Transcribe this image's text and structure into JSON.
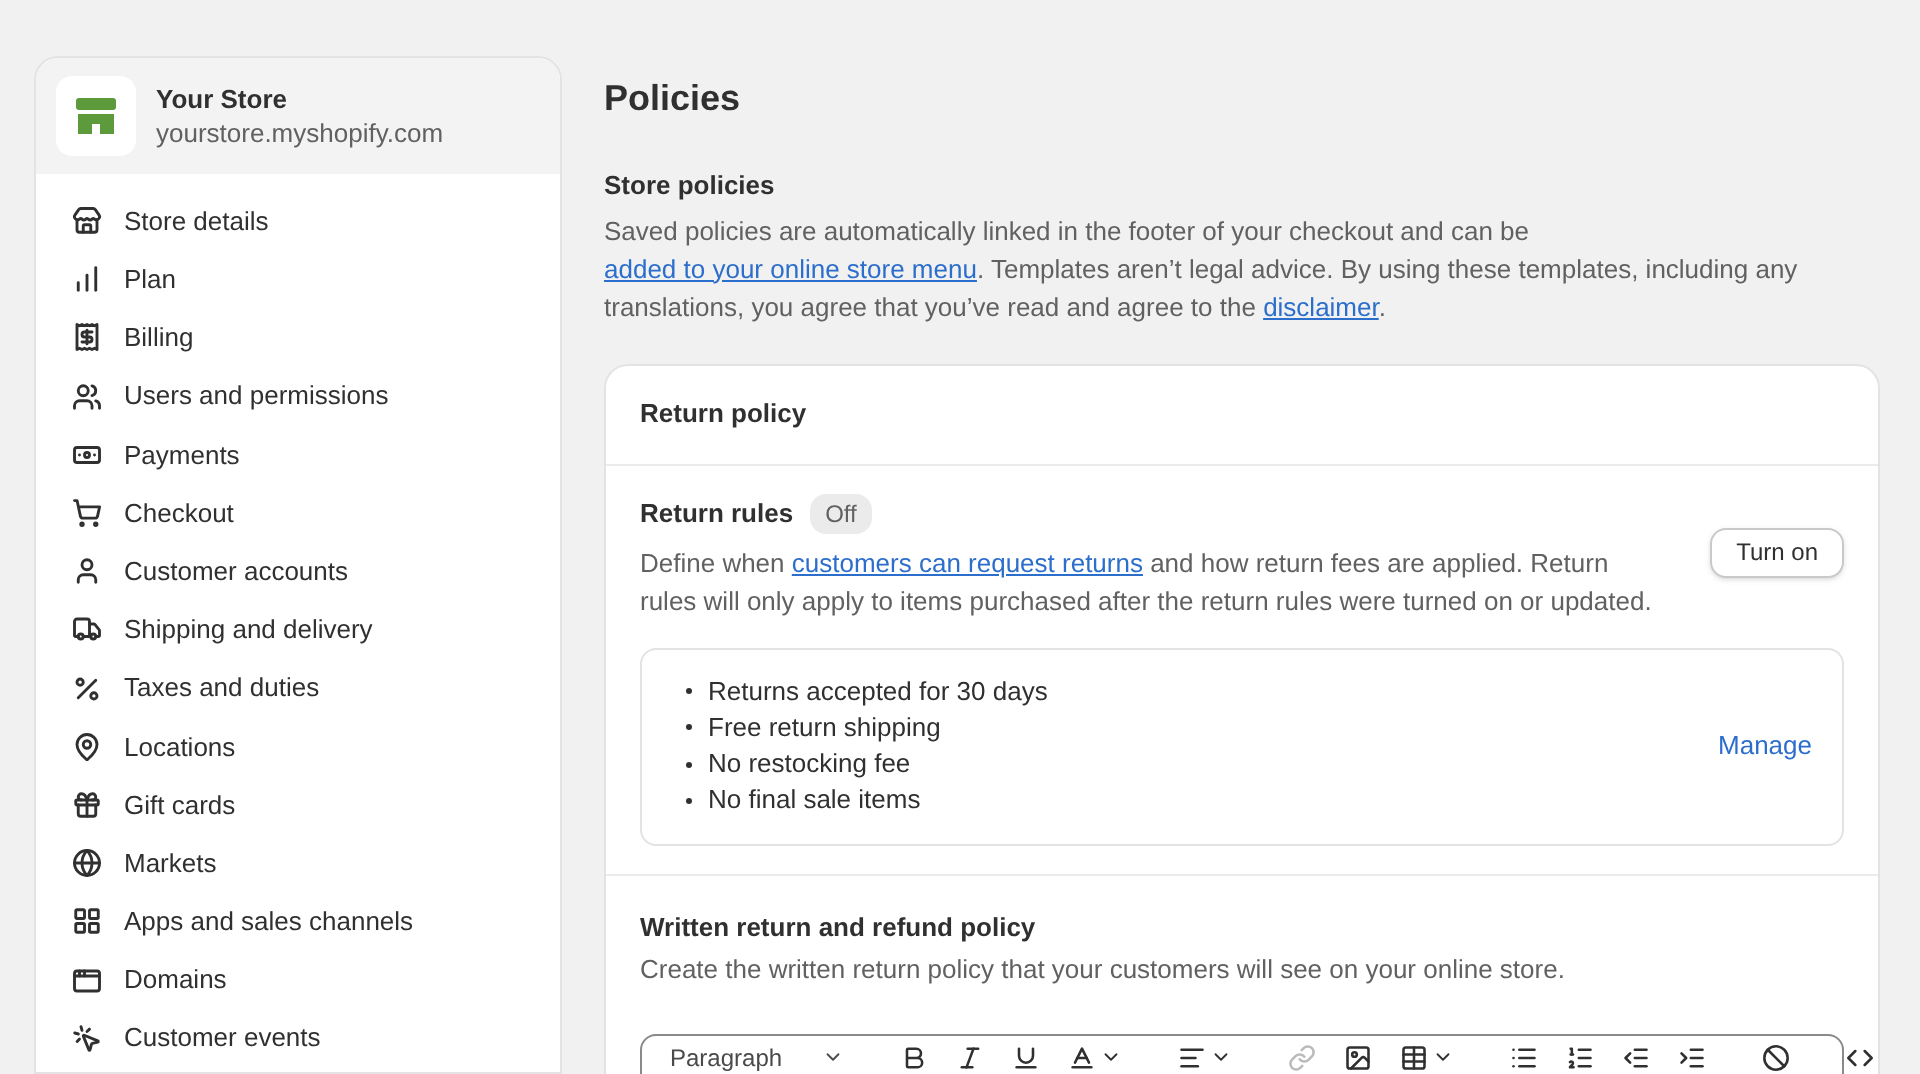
{
  "store": {
    "name": "Your Store",
    "url": "yourstore.myshopify.com"
  },
  "sidebar": {
    "items": [
      {
        "label": "Store details"
      },
      {
        "label": "Plan"
      },
      {
        "label": "Billing"
      },
      {
        "label": "Users and permissions"
      },
      {
        "label": "Payments"
      },
      {
        "label": "Checkout"
      },
      {
        "label": "Customer accounts"
      },
      {
        "label": "Shipping and delivery"
      },
      {
        "label": "Taxes and duties"
      },
      {
        "label": "Locations"
      },
      {
        "label": "Gift cards"
      },
      {
        "label": "Markets"
      },
      {
        "label": "Apps and sales channels"
      },
      {
        "label": "Domains"
      },
      {
        "label": "Customer events"
      }
    ]
  },
  "page_title": "Policies",
  "store_policies": {
    "heading": "Store policies",
    "description": [
      {
        "kind": "text",
        "text": "Saved policies are automatically linked in the footer of your checkout and can be "
      },
      {
        "kind": "link",
        "text": "added to your online store menu"
      },
      {
        "kind": "text",
        "text": ". Templates aren’t legal advice. By using these templates, including any translations, you agree that you’ve read and agree to the "
      },
      {
        "kind": "link",
        "text": "disclaimer"
      },
      {
        "kind": "text",
        "text": "."
      }
    ]
  },
  "return_policy": {
    "title": "Return policy",
    "return_rules": {
      "title": "Return rules",
      "status": "Off",
      "on": false,
      "description": [
        {
          "kind": "text",
          "text": "Define when "
        },
        {
          "kind": "link",
          "text": "customers can request returns"
        },
        {
          "kind": "text",
          "text": " and how return fees are applied. Return rules will only apply to items purchased after the return rules were turned on or updated."
        }
      ],
      "button": "Turn on",
      "rules": [
        "Returns accepted for 30 days",
        "Free return shipping",
        "No restocking fee",
        "No final sale items"
      ],
      "manage": "Manage"
    },
    "written_policy": {
      "title": "Written return and refund policy",
      "description": "Create the written return policy that your customers will see on your online store.",
      "editor": {
        "block_format": "Paragraph"
      }
    }
  }
}
